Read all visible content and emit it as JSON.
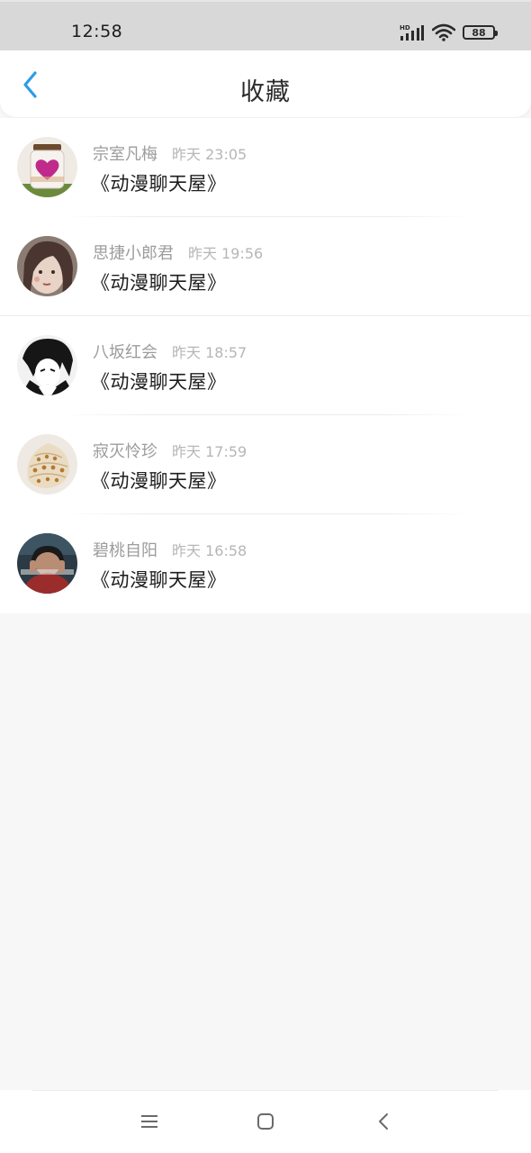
{
  "status_bar": {
    "time": "12:58",
    "network_label": "HD",
    "battery_level": "88",
    "icons": [
      "hd-signal-icon",
      "wifi-icon",
      "battery-icon"
    ]
  },
  "header": {
    "title": "收藏",
    "back_icon": "chevron-left-icon",
    "accent_color": "#2d9be8"
  },
  "favorites": [
    {
      "name": "宗室凡梅",
      "time": "昨天 23:05",
      "title": "《动漫聊天屋》",
      "avatar": "jar-heart-avatar"
    },
    {
      "name": "思捷小郎君",
      "time": "昨天 19:56",
      "title": "《动漫聊天屋》",
      "avatar": "girl-portrait-avatar"
    },
    {
      "name": "八坂红会",
      "time": "昨天 18:57",
      "title": "《动漫聊天屋》",
      "avatar": "anime-sketch-avatar"
    },
    {
      "name": "寂灭怜珍",
      "time": "昨天 17:59",
      "title": "《动漫聊天屋》",
      "avatar": "seashell-avatar"
    },
    {
      "name": "碧桃自阳",
      "time": "昨天 16:58",
      "title": "《动漫聊天屋》",
      "avatar": "boy-photo-avatar"
    }
  ],
  "nav_bar": {
    "icons": [
      "menu-icon",
      "home-icon",
      "back-icon"
    ]
  }
}
